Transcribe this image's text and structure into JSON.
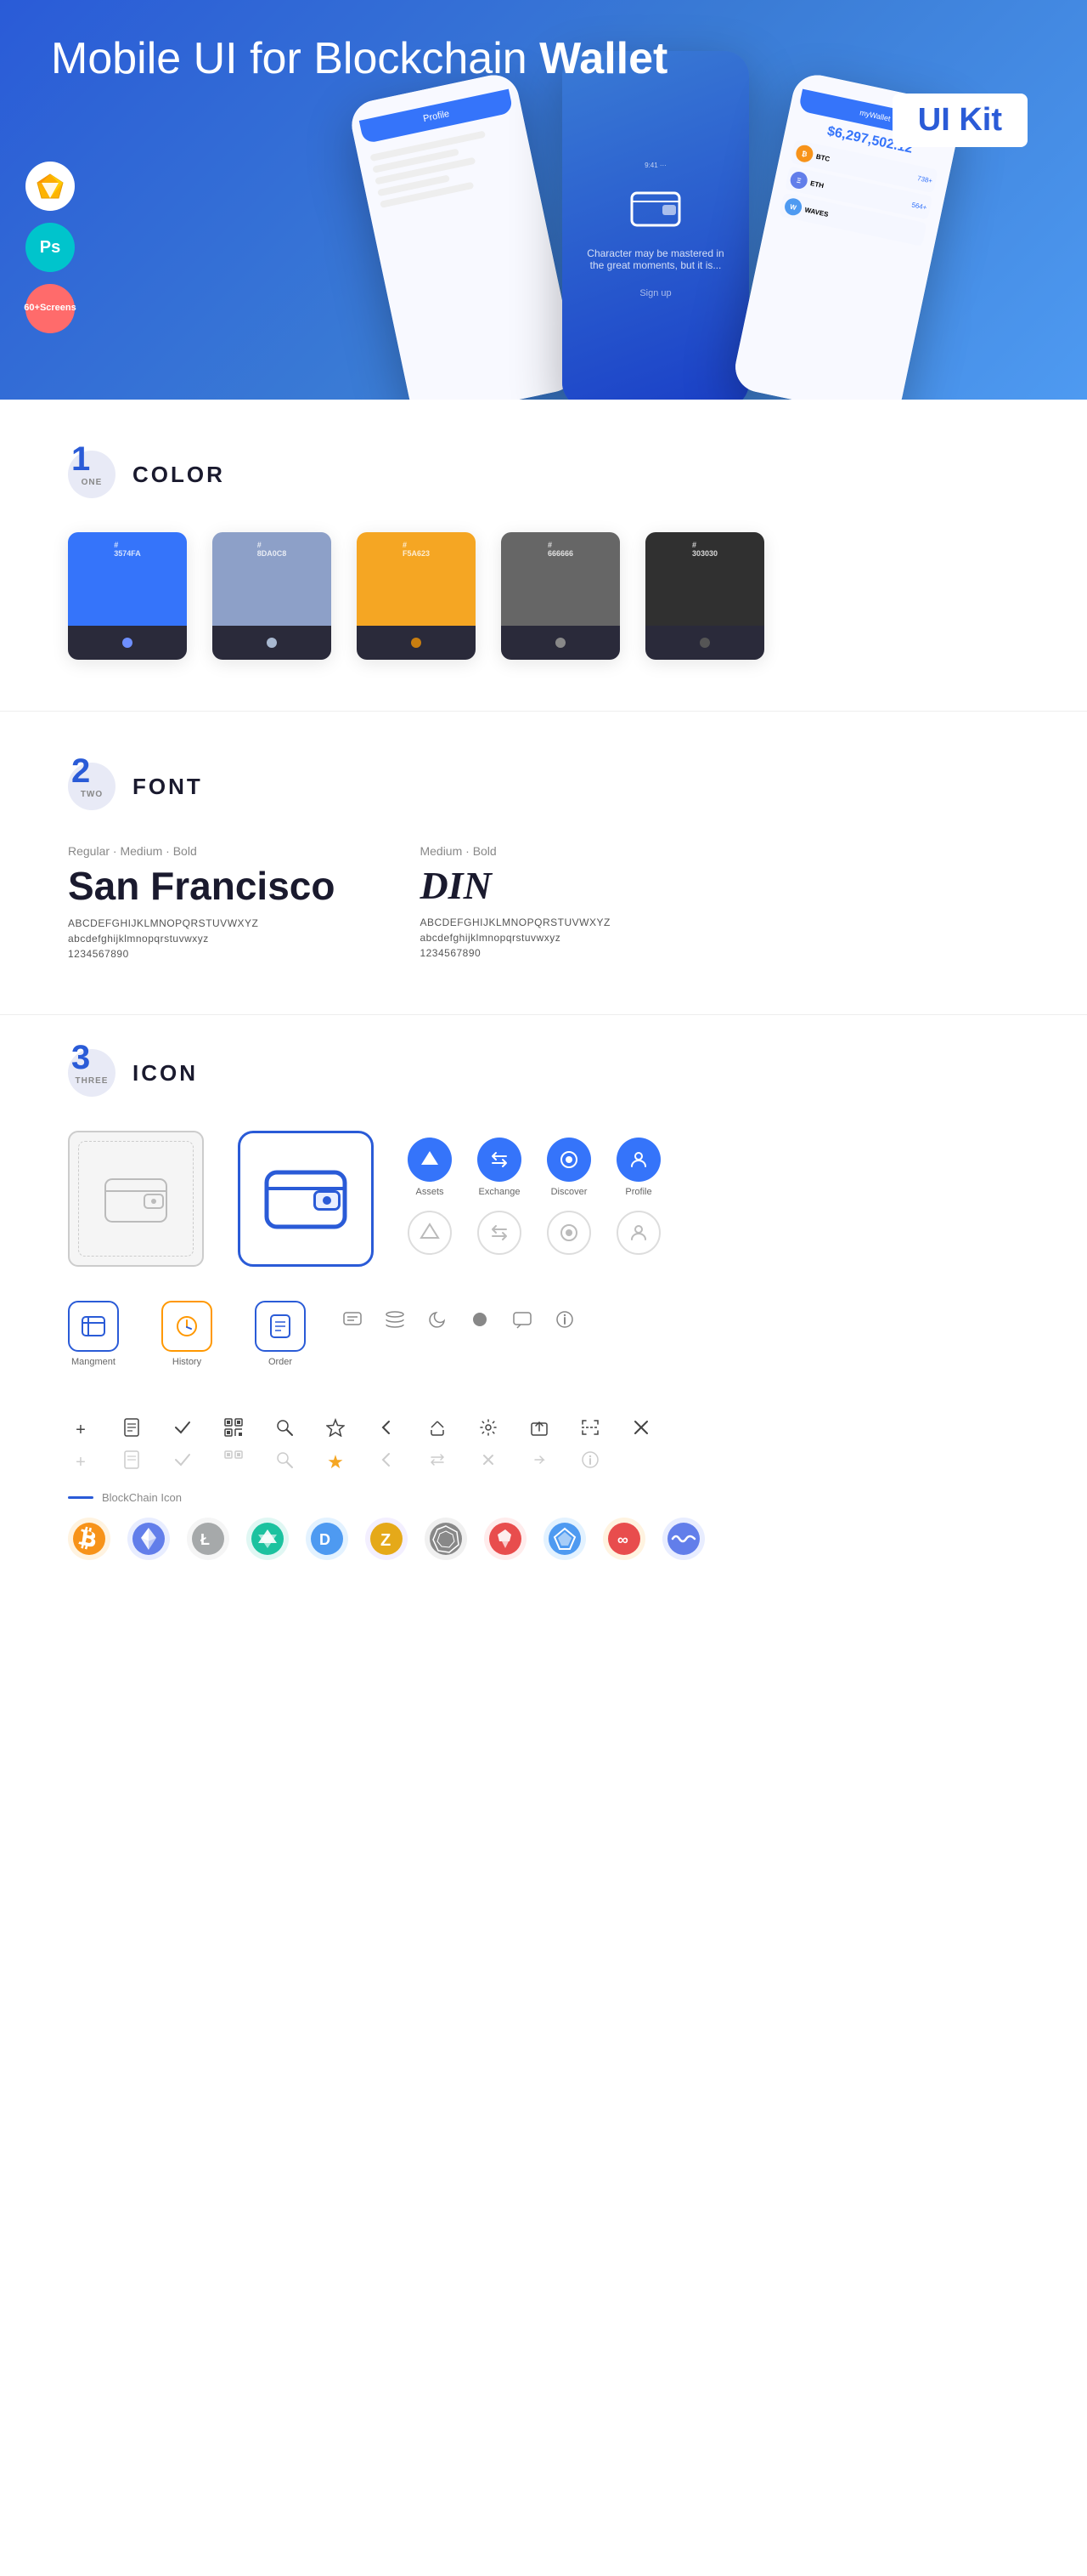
{
  "hero": {
    "title_regular": "Mobile UI for Blockchain ",
    "title_bold": "Wallet",
    "badge": "UI Kit",
    "badge_sketch": "🎨",
    "badge_ps": "Ps",
    "badge_screens_line1": "60+",
    "badge_screens_line2": "Screens"
  },
  "sections": {
    "color": {
      "number": "1",
      "number_text": "ONE",
      "title": "COLOR",
      "swatches": [
        {
          "hex": "#3574FA",
          "label": "#\n3574FA"
        },
        {
          "hex": "#8DA0C8",
          "label": "#\n8DA0C8"
        },
        {
          "hex": "#F5A623",
          "label": "#\nF5A623"
        },
        {
          "hex": "#666666",
          "label": "#\n666666"
        },
        {
          "hex": "#303030",
          "label": "#\n303030"
        }
      ]
    },
    "font": {
      "number": "2",
      "number_text": "TWO",
      "title": "FONT",
      "fonts": [
        {
          "style_label": "Regular · Medium · Bold",
          "name": "San Francisco",
          "name_class": "sf",
          "uppercase": "ABCDEFGHIJKLMNOPQRSTUVWXYZ",
          "lowercase": "abcdefghijklmnopqrstuvwxyz",
          "numbers": "1234567890"
        },
        {
          "style_label": "Medium · Bold",
          "name": "DIN",
          "name_class": "din",
          "uppercase": "ABCDEFGHIJKLMNOPQRSTUVWXYZ",
          "lowercase": "abcdefghijklmnopqrstuvwxyz",
          "numbers": "1234567890"
        }
      ]
    },
    "icon": {
      "number": "3",
      "number_text": "THREE",
      "title": "ICON",
      "nav_icons": [
        {
          "label": "Assets",
          "symbol": "◆"
        },
        {
          "label": "Exchange",
          "symbol": "⇄"
        },
        {
          "label": "Discover",
          "symbol": "⊕"
        },
        {
          "label": "Profile",
          "symbol": "👤"
        }
      ],
      "app_icons": [
        {
          "label": "Mangment",
          "symbol": "▤"
        },
        {
          "label": "History",
          "symbol": "🕐"
        },
        {
          "label": "Order",
          "symbol": "📋"
        }
      ],
      "misc_icons": [
        "💬",
        "≡",
        "◐",
        "●",
        "💬",
        "ℹ"
      ],
      "action_icons_filled": [
        "+",
        "📋",
        "✓",
        "⊞",
        "🔍",
        "☆",
        "‹",
        "≪",
        "⚙",
        "⬒",
        "⇄",
        "✕"
      ],
      "action_icons_outline": [
        "+",
        "📋",
        "✓",
        "⊞",
        "🔍",
        "☆",
        "‹",
        "≪",
        "⚙",
        "⬒",
        "⇄",
        "✕"
      ],
      "blockchain_label": "BlockChain Icon",
      "crypto_icons": [
        {
          "symbol": "₿",
          "color": "#f7931a",
          "bg": "#fff3e0"
        },
        {
          "symbol": "Ξ",
          "color": "#627eea",
          "bg": "#e8edff"
        },
        {
          "symbol": "Ł",
          "color": "#a6a9aa",
          "bg": "#f5f5f5"
        },
        {
          "symbol": "◈",
          "color": "#1cc29f",
          "bg": "#e0f7f3"
        },
        {
          "symbol": "D",
          "color": "#4e9af1",
          "bg": "#e3f2ff"
        },
        {
          "symbol": "Z",
          "color": "#b9a0e8",
          "bg": "#f3efff"
        },
        {
          "symbol": "⬡",
          "color": "#888",
          "bg": "#f0f0f0"
        },
        {
          "symbol": "▲",
          "color": "#e84d4d",
          "bg": "#ffecec"
        },
        {
          "symbol": "◆",
          "color": "#4e9af1",
          "bg": "#e3f2ff"
        },
        {
          "symbol": "∞",
          "color": "#e84d4d",
          "bg": "#ffecec"
        },
        {
          "symbol": "~",
          "color": "#627eea",
          "bg": "#e8edff"
        }
      ]
    }
  }
}
